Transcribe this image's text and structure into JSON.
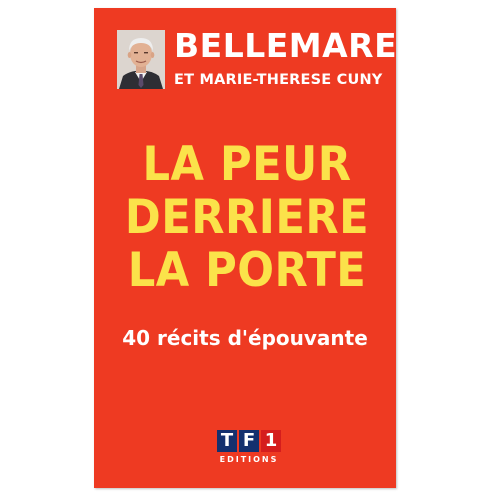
{
  "cover": {
    "author": "BELLEMARE",
    "coauthor": "ET MARIE-THERESE CUNY",
    "title_lines": [
      "LA PEUR",
      "DERRIERE",
      "LA PORTE"
    ],
    "subtitle": "40 récits d'épouvante",
    "publisher_logo_letters": [
      "T",
      "F",
      "1"
    ],
    "publisher_name": "EDITIONS",
    "colors": {
      "background": "#ee3a22",
      "title": "#fbe24a",
      "text": "#ffffff",
      "logo_blue": "#14306e",
      "logo_red": "#d51d1d"
    }
  }
}
